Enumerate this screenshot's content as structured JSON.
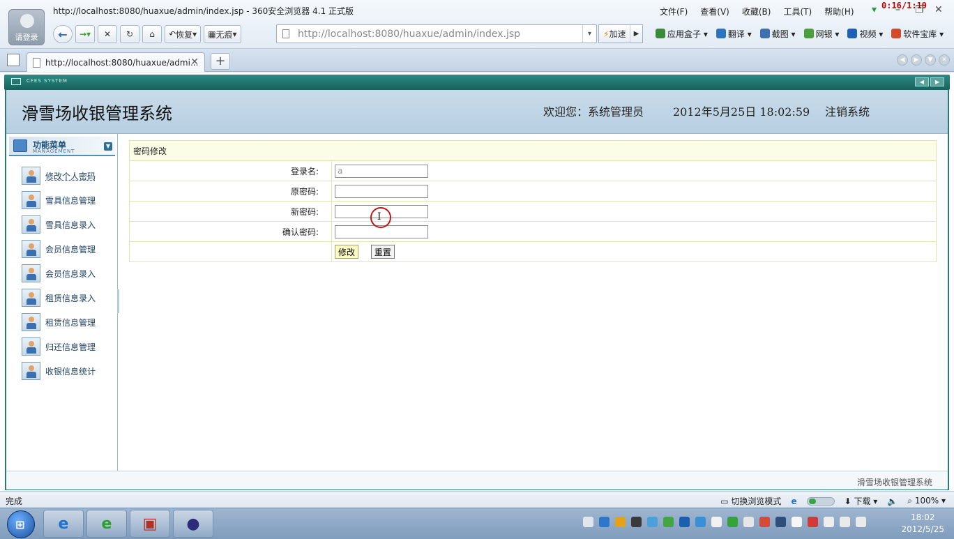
{
  "browser": {
    "title": "http://localhost:8080/huaxue/admin/index.jsp - 360安全浏览器 4.1 正式版",
    "login_label": "请登录",
    "menu": [
      "文件(F)",
      "查看(V)",
      "收藏(B)",
      "工具(T)",
      "帮助(H)"
    ],
    "overlay_timer": "0:16/1:19",
    "nav": {
      "restore_label": "恢复",
      "trace_label": "无痕",
      "speed_label": "加速"
    },
    "url": "http://localhost:8080/huaxue/admin/index.jsp",
    "tools": [
      {
        "label": "应用盒子",
        "color": "#3b8b3b"
      },
      {
        "label": "翻译",
        "color": "#2f74c0"
      },
      {
        "label": "截图",
        "color": "#3d6fb1"
      },
      {
        "label": "网银",
        "color": "#4b9e3c"
      },
      {
        "label": "视频",
        "color": "#1f5fb8"
      },
      {
        "label": "软件宝库",
        "color": "#d24a2a"
      }
    ],
    "tab_title": "http://localhost:8080/huaxue/admi...",
    "status_text": "完成",
    "status_right": {
      "switch_mode": "切换浏览模式",
      "download": "下载",
      "zoom": "100%"
    }
  },
  "strip_label": "CFES SYSTEM",
  "app": {
    "title": "滑雪场收银管理系统",
    "welcome": "欢迎您：系统管理员",
    "datetime": "2012年5月25日 18:02:59",
    "logout": "注销系统",
    "footer": "滑雪场收银管理系统"
  },
  "sidebar": {
    "header": "功能菜单",
    "header_sub": "MANAGEMENT",
    "items": [
      {
        "label": "修改个人密码"
      },
      {
        "label": "雪具信息管理"
      },
      {
        "label": "雪具信息录入"
      },
      {
        "label": "会员信息管理"
      },
      {
        "label": "会员信息录入"
      },
      {
        "label": "租赁信息录入"
      },
      {
        "label": "租赁信息管理"
      },
      {
        "label": "归还信息管理"
      },
      {
        "label": "收银信息统计"
      }
    ]
  },
  "form": {
    "caption": "密码修改",
    "login_label": "登录名:",
    "login_value": "a",
    "old_pwd_label": "原密码:",
    "new_pwd_label": "新密码:",
    "confirm_pwd_label": "确认密码:",
    "submit_label": "修改",
    "reset_label": "重置"
  },
  "taskbar": {
    "apps": [
      {
        "name": "internet-explorer",
        "glyph": "e",
        "color": "#1f6fd0"
      },
      {
        "name": "360-browser",
        "glyph": "e",
        "color": "#2aa12a"
      },
      {
        "name": "toolbox",
        "glyph": "▣",
        "color": "#b0302a"
      },
      {
        "name": "eclipse",
        "glyph": "●",
        "color": "#2c2d7a"
      }
    ],
    "time": "18:02",
    "date": "2012/5/25"
  }
}
